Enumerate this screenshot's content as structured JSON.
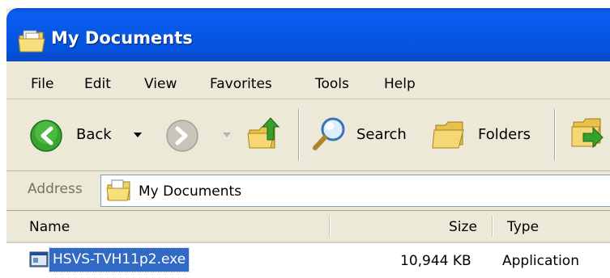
{
  "window": {
    "title": "My Documents"
  },
  "menu": [
    "File",
    "Edit",
    "View",
    "Favorites",
    "Tools",
    "Help"
  ],
  "toolbar": {
    "back_label": "Back",
    "search_label": "Search",
    "folders_label": "Folders"
  },
  "address": {
    "label": "Address",
    "value": "My Documents"
  },
  "columns": {
    "name": "Name",
    "size": "Size",
    "type": "Type"
  },
  "files": [
    {
      "name": "HSVS-TVH11p2.exe",
      "size": "10,944 KB",
      "type": "Application",
      "selected": true
    }
  ],
  "colors": {
    "titlebar": "#0858e6",
    "selection": "#316ac5",
    "chrome": "#ece9d8"
  }
}
